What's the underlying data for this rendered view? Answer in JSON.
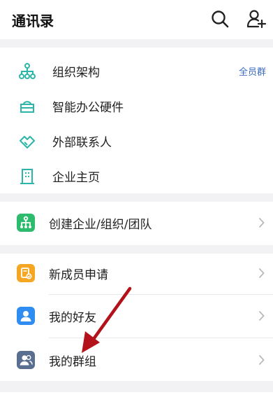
{
  "header": {
    "title": "通讯录",
    "search_icon": "search-icon",
    "add_user_icon": "add-user-icon"
  },
  "directory": {
    "items": [
      {
        "label": "组织架构",
        "icon": "org-tree-icon",
        "tag": "全员群"
      },
      {
        "label": "智能办公硬件",
        "icon": "hardware-icon"
      },
      {
        "label": "外部联系人",
        "icon": "handshake-icon"
      },
      {
        "label": "企业主页",
        "icon": "building-icon"
      }
    ]
  },
  "create_section": {
    "label": "创建企业/组织/团队",
    "icon": "org-tree-icon",
    "color": "#2dbb6d"
  },
  "people_section": {
    "items": [
      {
        "label": "新成员申请",
        "icon": "new-member-icon",
        "color": "#f5a623"
      },
      {
        "label": "我的好友",
        "icon": "person-icon",
        "color": "#2f8cf0"
      },
      {
        "label": "我的群组",
        "icon": "group-icon",
        "color": "#5a6f8f"
      }
    ]
  },
  "colors": {
    "accent_teal": "#2bb6a8",
    "arrow_red": "#b3121a"
  }
}
